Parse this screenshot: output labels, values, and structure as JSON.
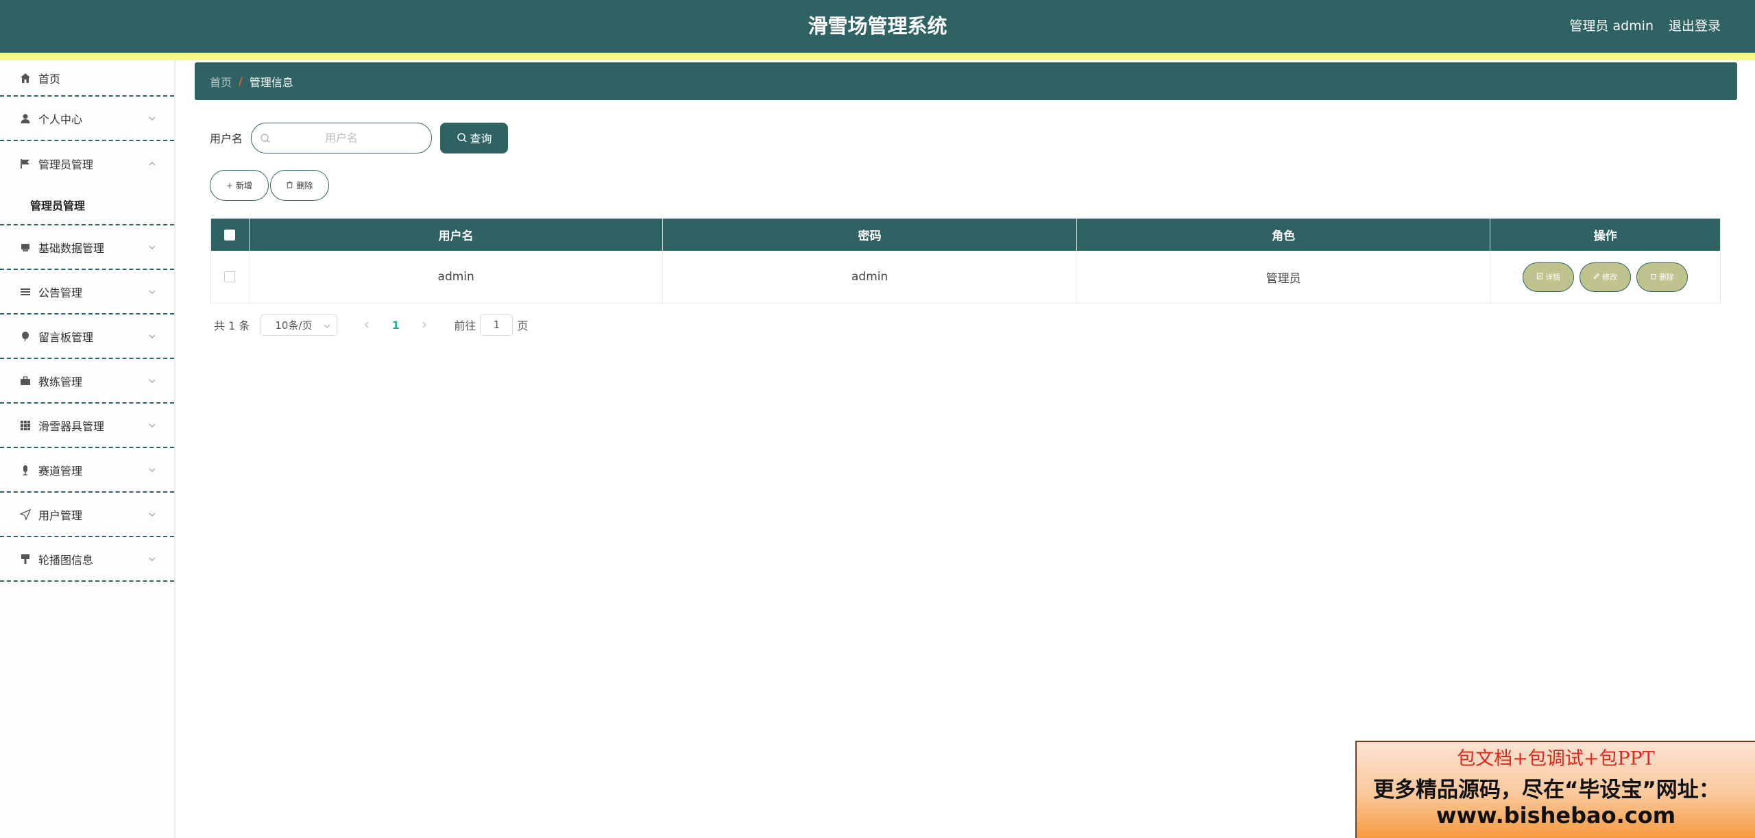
{
  "header": {
    "title": "滑雪场管理系统",
    "user_info": "管理员 admin",
    "logout": "退出登录"
  },
  "sidebar": {
    "items": [
      {
        "label": "首页",
        "icon": "home-icon"
      },
      {
        "label": "个人中心",
        "icon": "user-icon"
      },
      {
        "label": "管理员管理",
        "icon": "flag-icon",
        "expanded": true,
        "sub": [
          "管理员管理"
        ]
      },
      {
        "label": "基础数据管理",
        "icon": "printer-icon"
      },
      {
        "label": "公告管理",
        "icon": "list-icon"
      },
      {
        "label": "留言板管理",
        "icon": "balloon-icon"
      },
      {
        "label": "教练管理",
        "icon": "briefcase-icon"
      },
      {
        "label": "滑雪器具管理",
        "icon": "grid-icon"
      },
      {
        "label": "赛道管理",
        "icon": "microphone-icon"
      },
      {
        "label": "用户管理",
        "icon": "send-icon"
      },
      {
        "label": "轮播图信息",
        "icon": "brush-icon"
      }
    ]
  },
  "breadcrumb": {
    "home": "首页",
    "separator": "/",
    "current": "管理信息"
  },
  "search": {
    "label": "用户名",
    "placeholder": "用户名",
    "value": "",
    "button": "查询"
  },
  "actions": {
    "add": "新增",
    "delete": "删除"
  },
  "table": {
    "columns": [
      "用户名",
      "密码",
      "角色",
      "操作"
    ],
    "rows": [
      {
        "username": "admin",
        "password": "admin",
        "role": "管理员",
        "checked": false
      }
    ],
    "row_actions": {
      "detail": "详情",
      "edit": "修改",
      "delete": "删除"
    }
  },
  "pagination": {
    "total": "共 1 条",
    "page_size": "10条/页",
    "current_page": "1",
    "goto_label": "前往",
    "goto_value": "1",
    "page_suffix": "页"
  },
  "banner": {
    "line1": "包文档+包调试+包PPT",
    "line2": "更多精品源码，尽在“毕设宝”网址：",
    "line3": "www.bishebao.com"
  },
  "colors": {
    "primary": "#2e6263",
    "stripe": "#f7f987",
    "row_button": "#bfc48e",
    "pager_active": "#1ab394",
    "breadcrumb_separator": "#e0623a"
  }
}
